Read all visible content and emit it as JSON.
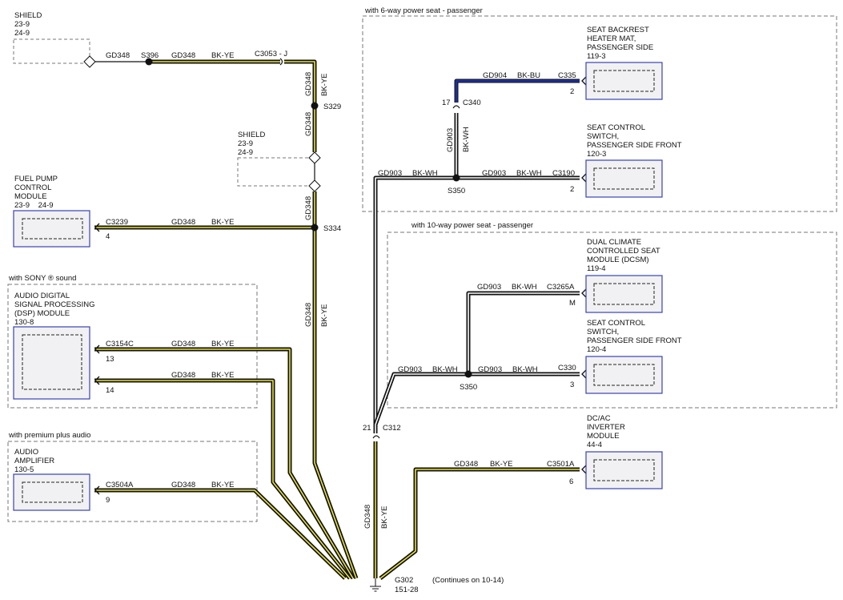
{
  "colors": {
    "bk_ye_stripe": "#e8e23a",
    "bk_wh_stripe": "#ffffff",
    "bk_bu_stripe": "#1e2f96",
    "module_border": "#3a42b3",
    "module_fill": "#f1f1f3",
    "region_border": "#777777"
  },
  "regions": {
    "six_way": "with 6-way power seat - passenger",
    "ten_way": "with 10-way power seat - passenger",
    "sony": "with SONY ® sound",
    "premium": "with premium plus audio"
  },
  "shields": [
    {
      "title": "SHIELD",
      "l1": "23-9",
      "l2": "24-9"
    },
    {
      "title": "SHIELD",
      "l1": "23-9",
      "l2": "24-9"
    }
  ],
  "modules": {
    "fpcm": {
      "lines": [
        "FUEL PUMP",
        "CONTROL",
        "MODULE",
        "23-9    24-9"
      ]
    },
    "dsp": {
      "lines": [
        "AUDIO DIGITAL",
        "SIGNAL PROCESSING",
        "(DSP) MODULE",
        "130-8"
      ]
    },
    "amp": {
      "lines": [
        "AUDIO",
        "AMPLIFIER",
        "130-5"
      ]
    },
    "backrest": {
      "lines": [
        "SEAT BACKREST",
        "HEATER MAT,",
        "PASSENGER SIDE",
        "119-3"
      ]
    },
    "switch6": {
      "lines": [
        "SEAT CONTROL",
        "SWITCH,",
        "PASSENGER SIDE FRONT",
        "120-3"
      ]
    },
    "dcsm": {
      "lines": [
        "DUAL CLIMATE",
        "CONTROLLED SEAT",
        "MODULE (DCSM)",
        "119-4"
      ]
    },
    "switch10": {
      "lines": [
        "SEAT CONTROL",
        "SWITCH,",
        "PASSENGER SIDE FRONT",
        "120-4"
      ]
    },
    "inverter": {
      "lines": [
        "DC/AC",
        "INVERTER",
        "MODULE",
        "44-4"
      ]
    }
  },
  "wire_labels": {
    "gd348": "GD348",
    "gd903": "GD903",
    "gd904": "GD904",
    "bk_ye": "BK-YE",
    "bk_wh": "BK-WH",
    "bk_bu": "BK-BU"
  },
  "splices": {
    "s396": "S396",
    "s329": "S329",
    "s334": "S334",
    "s350a": "S350",
    "s350b": "S350"
  },
  "connectors": {
    "c3053": "C3053 - J",
    "c3239": "C3239",
    "c3239_pin": "4",
    "c3154c": "C3154C",
    "c3154c_pin_a": "13",
    "c3154c_pin_b": "14",
    "c3504a": "C3504A",
    "c3504a_pin": "9",
    "c335": "C335",
    "c335_pin": "2",
    "c340": "C340",
    "c340_pin": "17",
    "c3190": "C3190",
    "c3190_pin": "2",
    "c3265a": "C3265A",
    "c3265a_pin": "M",
    "c330": "C330",
    "c330_pin": "3",
    "c312": "C312",
    "c312_pin": "21",
    "c3501a": "C3501A",
    "c3501a_pin": "6"
  },
  "ground": {
    "id": "G302",
    "ref": "151-28",
    "note": "(Continues on 10-14)"
  }
}
